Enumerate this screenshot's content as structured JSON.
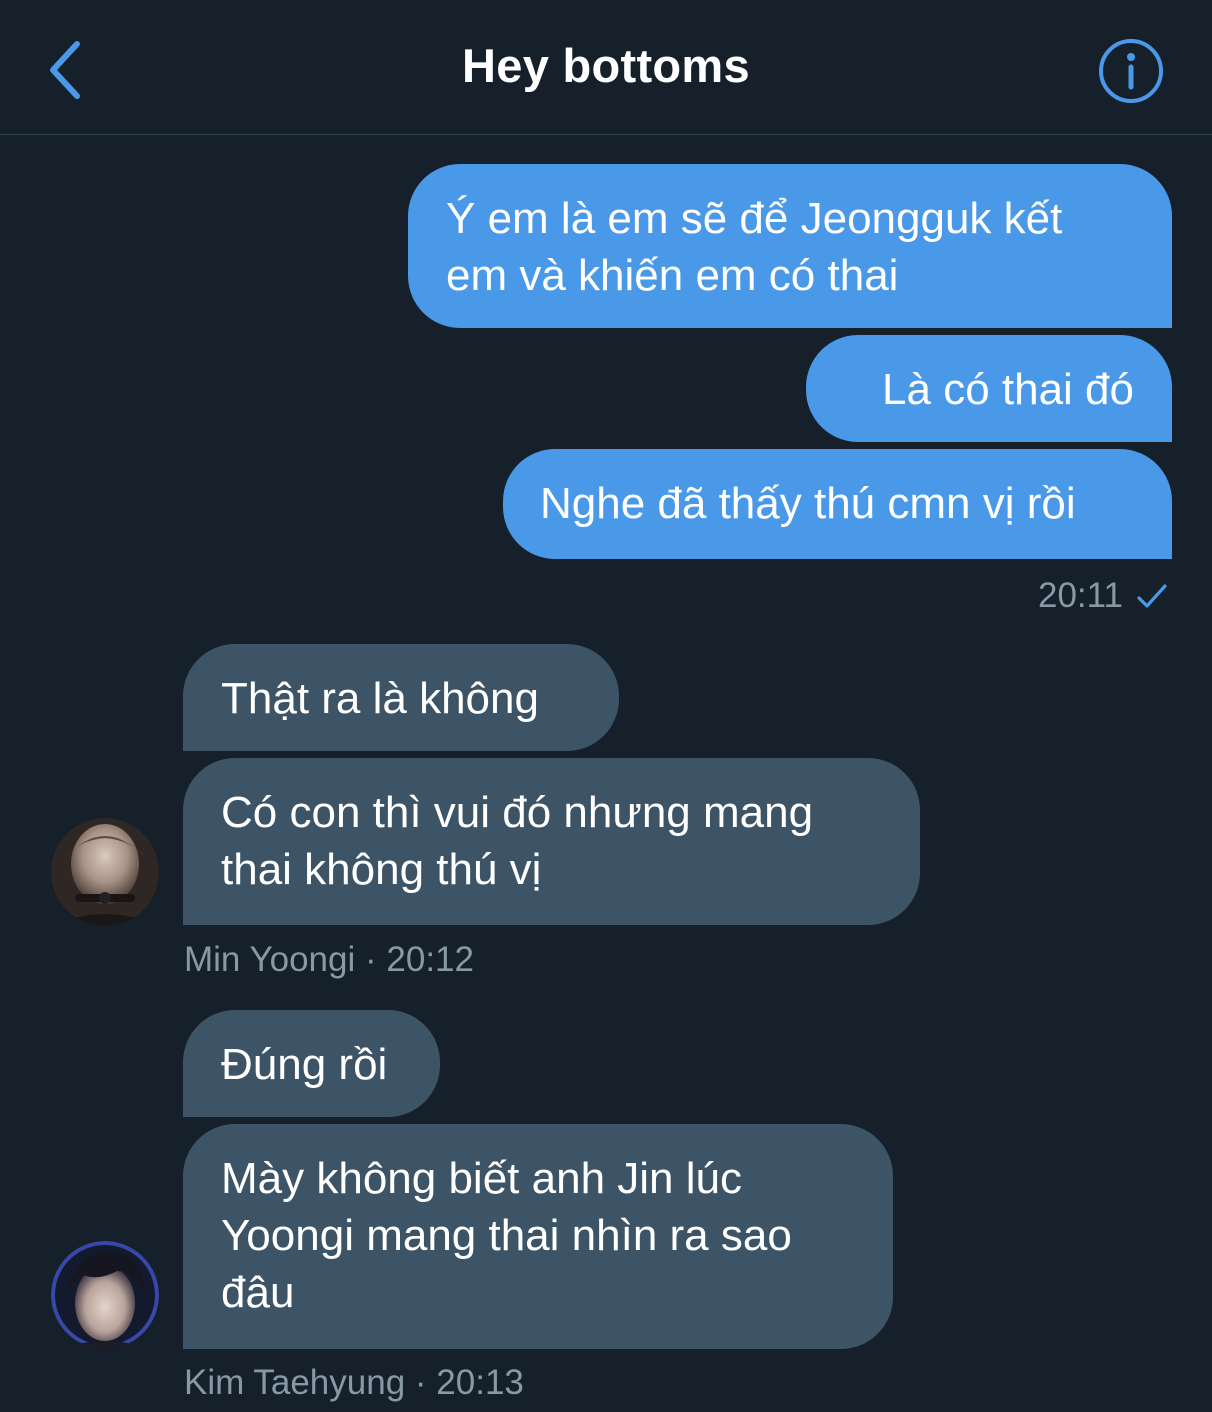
{
  "header": {
    "title": "Hey bottoms",
    "back_icon": "chevron-left-icon",
    "info_icon": "info-circle-icon",
    "accent_color": "#4a99e9"
  },
  "outgoing": {
    "messages": [
      "Ý em là em sẽ để Jeongguk kết em và khiến em có thai",
      "Là có thai đó",
      "Nghe đã thấy thú cmn vị rồi"
    ],
    "time": "20:11",
    "status_icon": "checkmark-icon",
    "bubble_color": "#4a99e9"
  },
  "groups": [
    {
      "sender": "Min Yoongi",
      "time": "20:12",
      "separator": "·",
      "messages": [
        "Thật ra là không",
        "Có con thì vui đó nhưng mang thai không thú vị"
      ]
    },
    {
      "sender": "Kim Taehyung",
      "time": "20:13",
      "separator": "·",
      "messages": [
        "Đúng rồi",
        "Mày không biết anh Jin lúc Yoongi mang thai nhìn ra sao đâu"
      ]
    }
  ],
  "colors": {
    "background": "#15202b",
    "incoming_bubble": "#3d5466",
    "meta_text": "#8899a6"
  }
}
